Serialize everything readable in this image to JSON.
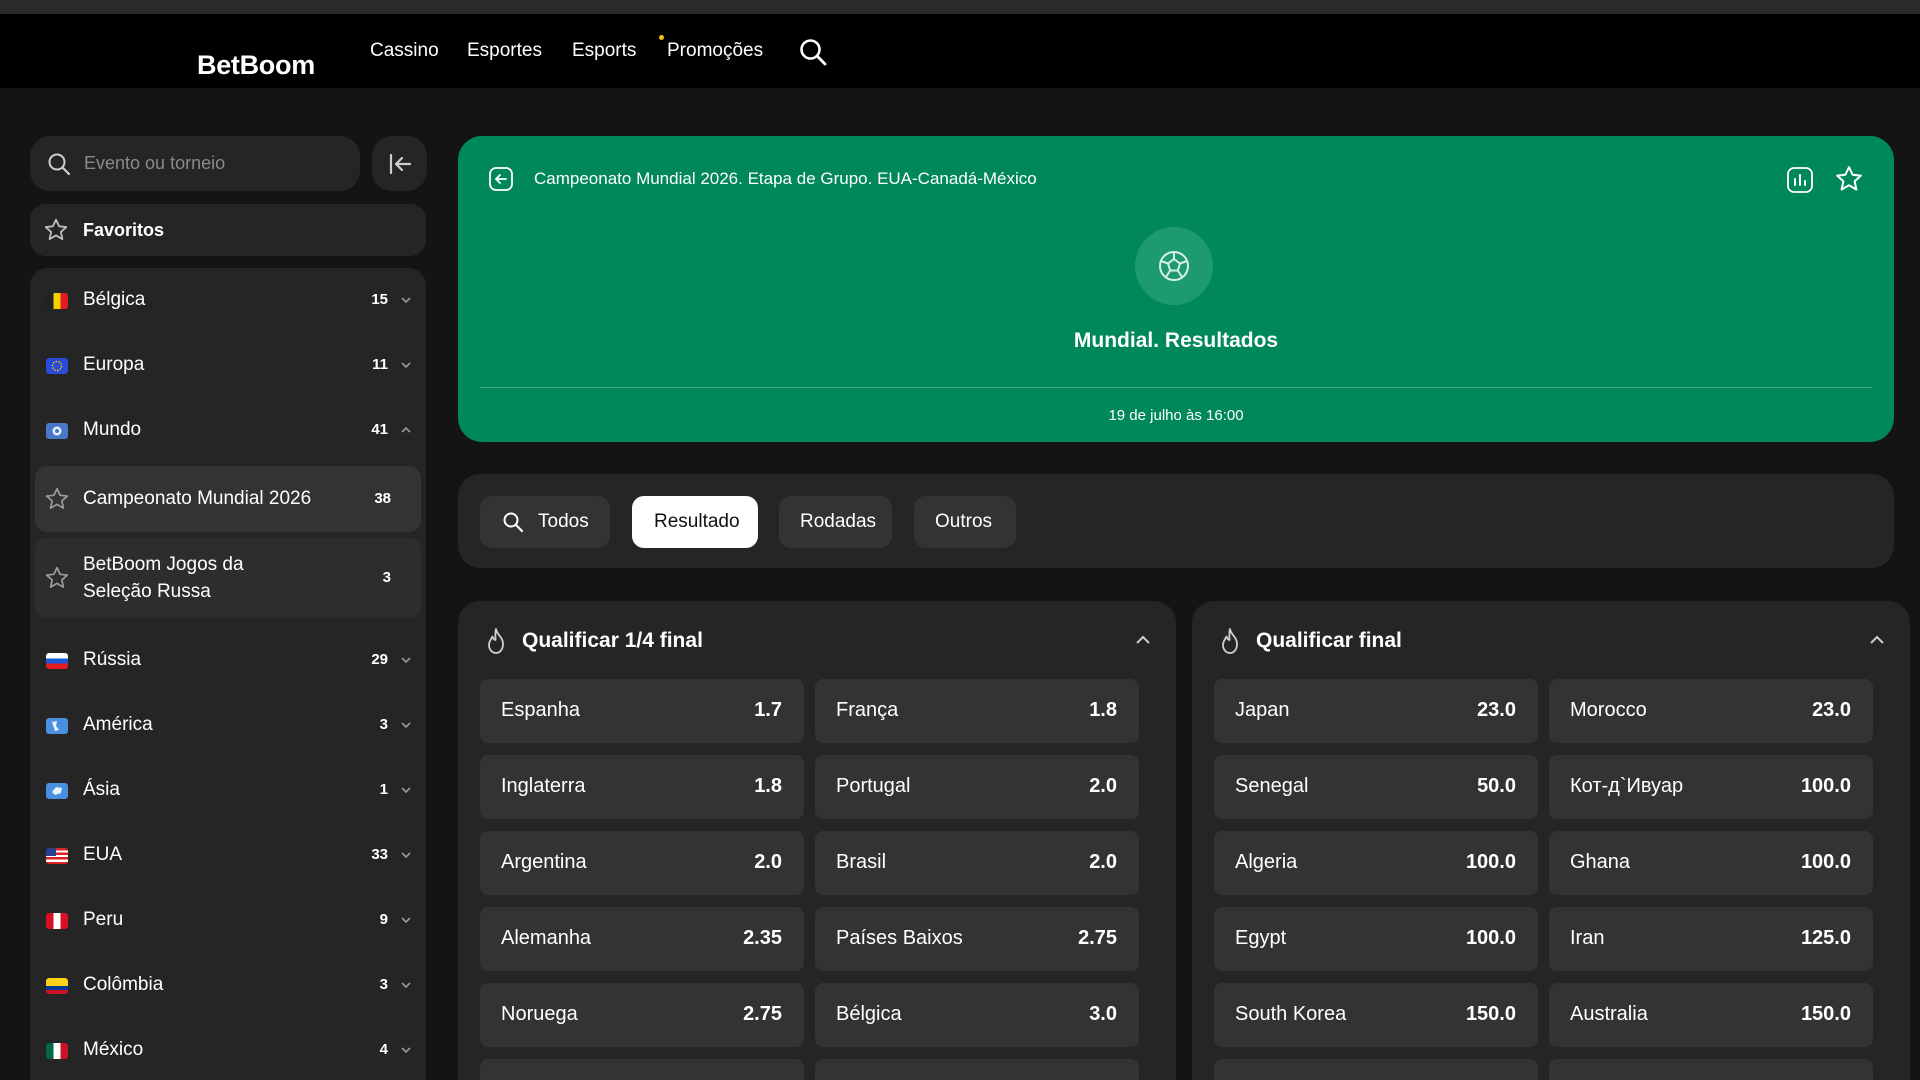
{
  "header": {
    "logo": "BetBoom",
    "nav": [
      "Cassino",
      "Esportes",
      "Esports",
      "Promoções"
    ]
  },
  "sidebar": {
    "search_placeholder": "Evento ou torneio",
    "favorites_label": "Favoritos",
    "items": [
      {
        "label": "Bélgica",
        "count": "15"
      },
      {
        "label": "Europa",
        "count": "11"
      },
      {
        "label": "Mundo",
        "count": "41"
      },
      {
        "label": "Rússia",
        "count": "29"
      },
      {
        "label": "América",
        "count": "3"
      },
      {
        "label": "Ásia",
        "count": "1"
      },
      {
        "label": "EUA",
        "count": "33"
      },
      {
        "label": "Peru",
        "count": "9"
      },
      {
        "label": "Colômbia",
        "count": "3"
      },
      {
        "label": "México",
        "count": "4"
      }
    ],
    "subitems": [
      {
        "label": "Campeonato Mundial 2026",
        "count": "38"
      },
      {
        "label": "BetBoom Jogos da Seleção Russa",
        "count": "3"
      }
    ]
  },
  "banner": {
    "breadcrumb": "Campeonato Mundial 2026. Etapa de Grupo. EUA-Canadá-México",
    "title": "Mundial. Resultados",
    "date": "19 de julho às 16:00"
  },
  "tabs": [
    "Todos",
    "Resultado",
    "Rodadas",
    "Outros"
  ],
  "markets": [
    {
      "title": "Qualificar 1/4 final",
      "outcomes": [
        {
          "name": "Espanha",
          "odds": "1.7"
        },
        {
          "name": "França",
          "odds": "1.8"
        },
        {
          "name": "Inglaterra",
          "odds": "1.8"
        },
        {
          "name": "Portugal",
          "odds": "2.0"
        },
        {
          "name": "Argentina",
          "odds": "2.0"
        },
        {
          "name": "Brasil",
          "odds": "2.0"
        },
        {
          "name": "Alemanha",
          "odds": "2.35"
        },
        {
          "name": "Países Baixos",
          "odds": "2.75"
        },
        {
          "name": "Noruega",
          "odds": "2.75"
        },
        {
          "name": "Bélgica",
          "odds": "3.0"
        }
      ]
    },
    {
      "title": "Qualificar final",
      "outcomes": [
        {
          "name": "Japan",
          "odds": "23.0"
        },
        {
          "name": "Morocco",
          "odds": "23.0"
        },
        {
          "name": "Senegal",
          "odds": "50.0"
        },
        {
          "name": "Кот-д`Ивуар",
          "odds": "100.0"
        },
        {
          "name": "Algeria",
          "odds": "100.0"
        },
        {
          "name": "Ghana",
          "odds": "100.0"
        },
        {
          "name": "Egypt",
          "odds": "100.0"
        },
        {
          "name": "Iran",
          "odds": "125.0"
        },
        {
          "name": "South Korea",
          "odds": "150.0"
        },
        {
          "name": "Australia",
          "odds": "150.0"
        }
      ]
    }
  ],
  "colors": {
    "background": "#141414",
    "topbar": "#000000",
    "panel": "#252525",
    "cell": "#333333",
    "banner": "#00875a",
    "text": "#ffffff"
  },
  "icons": {
    "search": "search-icon",
    "collapse": "collapse-sidebar-icon",
    "star": "star-icon",
    "back": "back-arrow-icon",
    "stats": "stats-icon",
    "ball": "soccer-ball-icon",
    "fire": "fire-icon",
    "chevron": "chevron-icon"
  }
}
